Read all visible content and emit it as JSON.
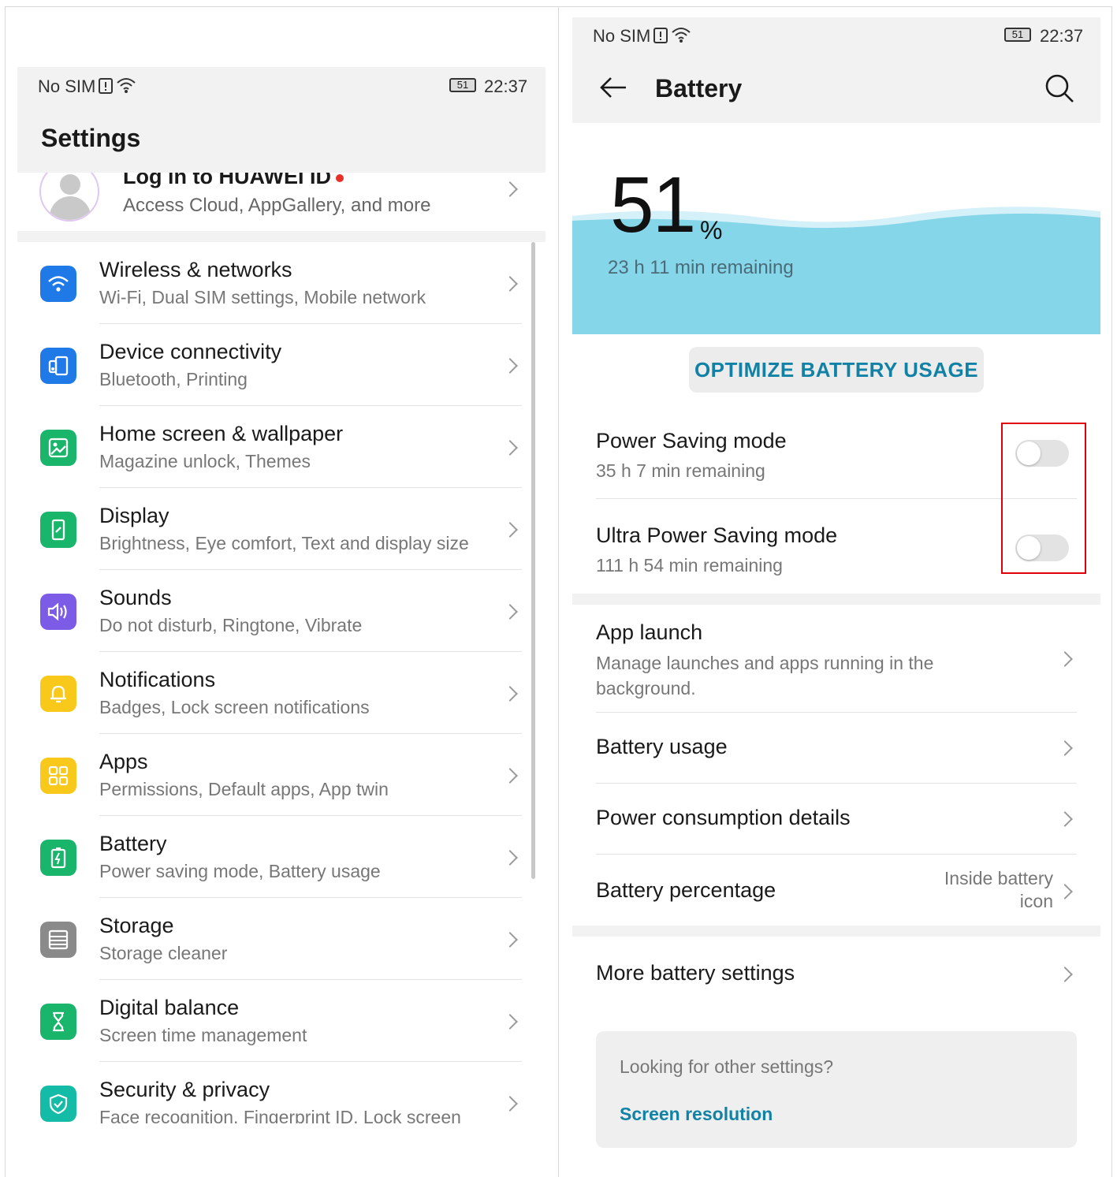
{
  "left_screen": {
    "status_bar": {
      "carrier": "No SIM",
      "battery_level": "51",
      "time": "22:37"
    },
    "title": "Settings",
    "account": {
      "title": "Log in to HUAWEI ID",
      "subtitle": "Access Cloud, AppGallery, and more"
    },
    "items": [
      {
        "title": "Wireless & networks",
        "subtitle": "Wi-Fi, Dual SIM settings, Mobile network",
        "icon": "wifi-icon",
        "color": "#1f7ae8"
      },
      {
        "title": "Device connectivity",
        "subtitle": "Bluetooth, Printing",
        "icon": "device-connectivity-icon",
        "color": "#1f7ae8"
      },
      {
        "title": "Home screen & wallpaper",
        "subtitle": "Magazine unlock, Themes",
        "icon": "wallpaper-icon",
        "color": "#18b56a"
      },
      {
        "title": "Display",
        "subtitle": "Brightness, Eye comfort, Text and display size",
        "icon": "display-icon",
        "color": "#18b56a"
      },
      {
        "title": "Sounds",
        "subtitle": "Do not disturb, Ringtone, Vibrate",
        "icon": "sound-icon",
        "color": "#7c5ce6"
      },
      {
        "title": "Notifications",
        "subtitle": "Badges, Lock screen notifications",
        "icon": "bell-icon",
        "color": "#f8c81a"
      },
      {
        "title": "Apps",
        "subtitle": "Permissions, Default apps, App twin",
        "icon": "apps-icon",
        "color": "#f8c81a"
      },
      {
        "title": "Battery",
        "subtitle": "Power saving mode, Battery usage",
        "icon": "battery-icon",
        "color": "#18b56a"
      },
      {
        "title": "Storage",
        "subtitle": "Storage cleaner",
        "icon": "storage-icon",
        "color": "#8a8a8a"
      },
      {
        "title": "Digital balance",
        "subtitle": "Screen time management",
        "icon": "hourglass-icon",
        "color": "#18b56a"
      },
      {
        "title": "Security & privacy",
        "subtitle": "Face recognition, Fingerprint ID, Lock screen",
        "icon": "shield-icon",
        "color": "#14bba6"
      }
    ]
  },
  "right_screen": {
    "status_bar": {
      "carrier": "No SIM",
      "battery_level": "51",
      "time": "22:37"
    },
    "title": "Battery",
    "battery": {
      "percent": "51",
      "percent_sign": "%",
      "remaining": "23 h 11 min remaining"
    },
    "optimize_button": "OPTIMIZE BATTERY USAGE",
    "modes": [
      {
        "title": "Power Saving mode",
        "subtitle": "35 h 7 min remaining",
        "enabled": false
      },
      {
        "title": "Ultra Power Saving mode",
        "subtitle": "111 h 54 min remaining",
        "enabled": false
      }
    ],
    "items": [
      {
        "title": "App launch",
        "subtitle": "Manage launches and apps running in the background."
      },
      {
        "title": "Battery usage"
      },
      {
        "title": "Power consumption details"
      },
      {
        "title": "Battery percentage",
        "value": "Inside battery icon"
      }
    ],
    "more": {
      "title": "More battery settings"
    },
    "hint": {
      "question": "Looking for other settings?",
      "link": "Screen resolution"
    },
    "accent_color": "#1182a6",
    "highlight_color": "#e0000a"
  }
}
